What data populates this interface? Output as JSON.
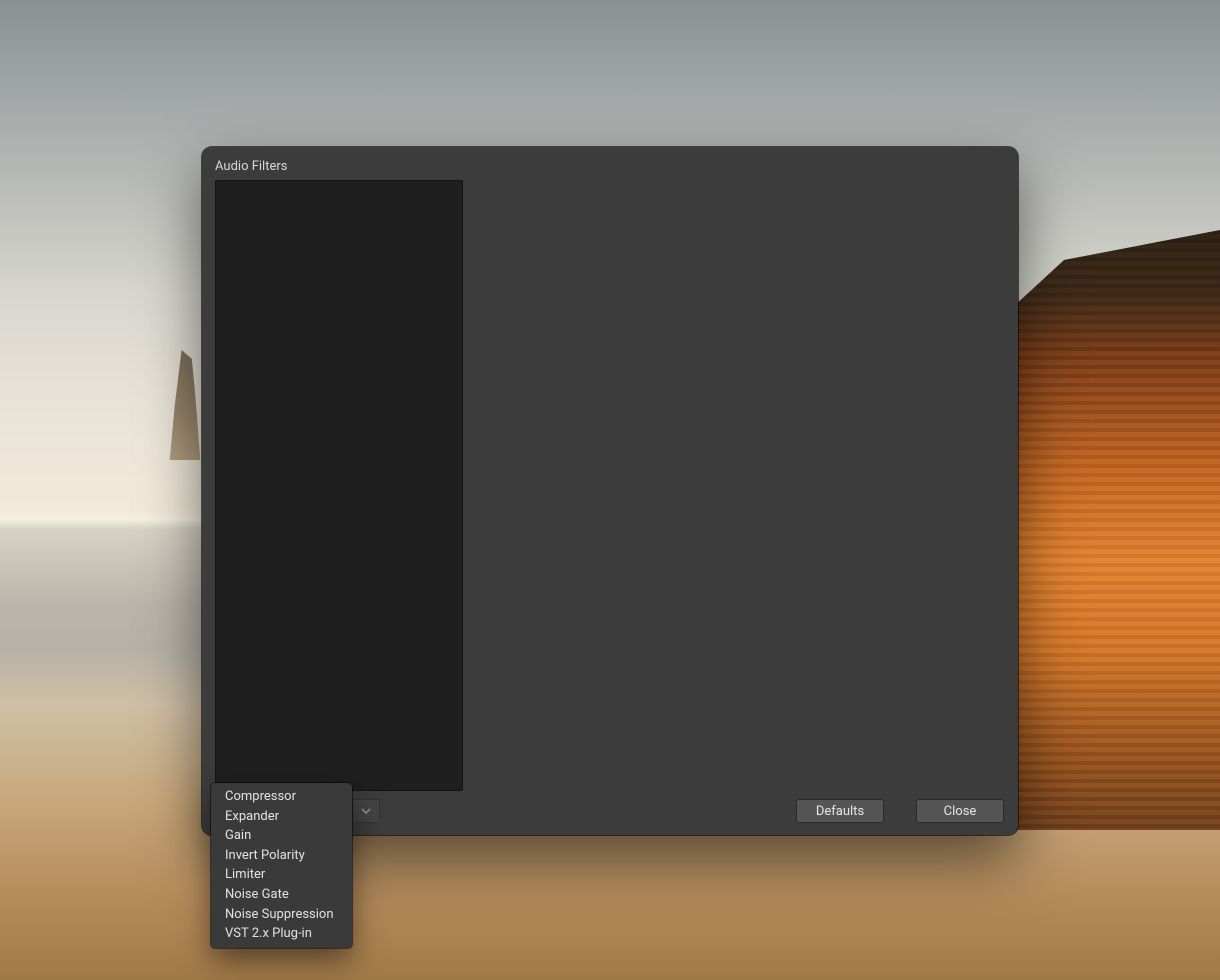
{
  "dialog": {
    "title": "Audio Filters",
    "buttons": {
      "defaults": "Defaults",
      "close": "Close"
    }
  },
  "context_menu": {
    "items": [
      "Compressor",
      "Expander",
      "Gain",
      "Invert Polarity",
      "Limiter",
      "Noise Gate",
      "Noise Suppression",
      "VST 2.x Plug-in"
    ]
  },
  "icons": {
    "add": "plus-icon",
    "remove": "minus-icon",
    "settings": "gear-icon",
    "move_up": "chevron-up-icon",
    "move_down": "chevron-down-icon"
  }
}
